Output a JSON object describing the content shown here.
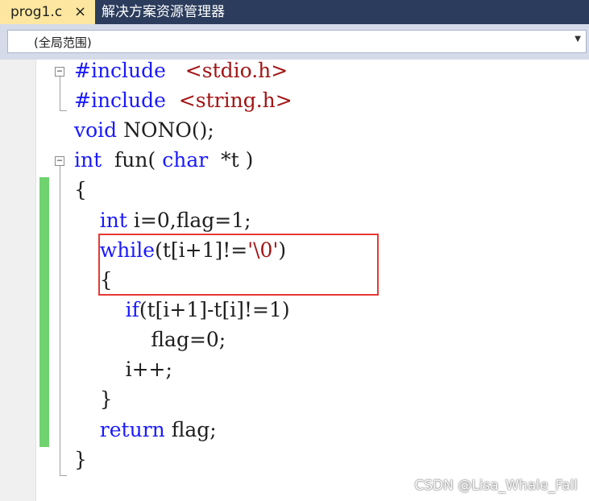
{
  "tabs": {
    "active_label": "prog1.c",
    "close_glyph": "×",
    "inactive_label": "解决方案资源管理器"
  },
  "scope": {
    "value": "(全局范围)",
    "arrow": "▼"
  },
  "editor": {
    "lines": [
      {
        "tokens": [
          {
            "t": "#include",
            "c": "kw"
          },
          {
            "t": "   "
          },
          {
            "t": "<stdio.h>",
            "c": "str"
          }
        ]
      },
      {
        "tokens": [
          {
            "t": "#include",
            "c": "kw"
          },
          {
            "t": "  "
          },
          {
            "t": "<string.h>",
            "c": "str"
          }
        ]
      },
      {
        "tokens": [
          {
            "t": "void",
            "c": "kw"
          },
          {
            "t": " NONO();"
          }
        ]
      },
      {
        "tokens": [
          {
            "t": "int",
            "c": "kw"
          },
          {
            "t": "  fun( "
          },
          {
            "t": "char",
            "c": "kw"
          },
          {
            "t": "  *t )"
          }
        ]
      },
      {
        "tokens": [
          {
            "t": "{"
          }
        ]
      },
      {
        "tokens": [
          {
            "t": "    "
          },
          {
            "t": "int",
            "c": "kw"
          },
          {
            "t": " i=0,flag=1;"
          }
        ]
      },
      {
        "tokens": [
          {
            "t": "    "
          },
          {
            "t": "while",
            "c": "kw"
          },
          {
            "t": "(t[i+1]!="
          },
          {
            "t": "'\\0'",
            "c": "str"
          },
          {
            "t": ")"
          }
        ]
      },
      {
        "tokens": [
          {
            "t": "    {"
          }
        ]
      },
      {
        "tokens": [
          {
            "t": "        "
          },
          {
            "t": "if",
            "c": "kw"
          },
          {
            "t": "(t[i+1]-t[i]!=1)"
          }
        ]
      },
      {
        "tokens": [
          {
            "t": "            flag=0;"
          }
        ]
      },
      {
        "tokens": [
          {
            "t": "        i++;"
          }
        ]
      },
      {
        "tokens": [
          {
            "t": "    }"
          }
        ]
      },
      {
        "tokens": [
          {
            "t": "    "
          },
          {
            "t": "return",
            "c": "kw"
          },
          {
            "t": " flag;"
          }
        ]
      },
      {
        "tokens": [
          {
            "t": "}"
          }
        ]
      }
    ]
  },
  "fold": {
    "collapse_glyph": "−"
  },
  "watermark": "CSDN @Lisa_Whale_Fall",
  "colors": {
    "keyword": "#1a1aff",
    "string": "#a31515",
    "change_bar": "#6fd36f",
    "highlight": "#e53935",
    "tab_active_bg": "#fde7a0",
    "tabbar_bg": "#2b3c5c"
  }
}
